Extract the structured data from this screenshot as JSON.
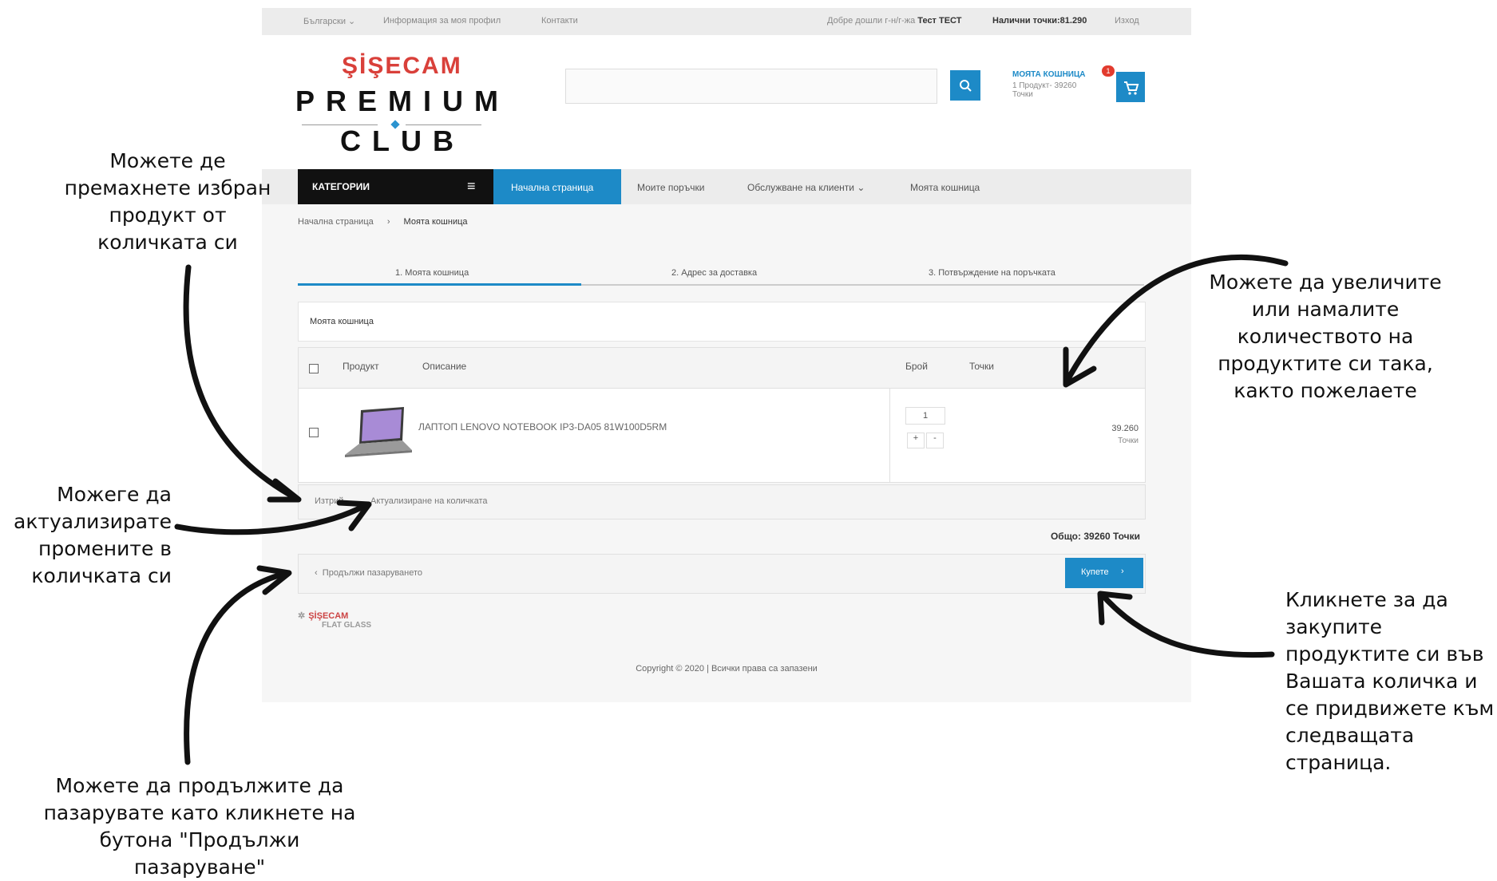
{
  "topbar": {
    "language": "Български",
    "profile": "Информация за моя профил",
    "contacts": "Контакти",
    "welcome": "Добре дошли г-н/г-жа",
    "user": "Тест ТЕСТ",
    "points": "Налични точки:81.290",
    "logout": "Изход"
  },
  "logo": {
    "brand": "ŞİŞECAM",
    "premium": "PREMIUM",
    "club": "CLUB"
  },
  "search": {
    "placeholder": ""
  },
  "cart": {
    "title": "МОЯТА КОШНИЦА",
    "count": "1",
    "summary": "1 Продукт- 39260",
    "unit": "Точки"
  },
  "nav": {
    "categories": "КАТЕГОРИИ",
    "home": "Начална страница",
    "orders": "Моите поръчки",
    "service": "Обслужване на клиенти",
    "cart": "Моята кошница"
  },
  "breadcrumb": {
    "home": "Начална страница",
    "sep": "›",
    "current": "Моята кошница"
  },
  "steps": [
    "1. Моята кошница",
    "2. Адрес за доставка",
    "3. Потвърждение на поръчката"
  ],
  "panel_title": "Моята кошница",
  "table": {
    "headers": {
      "product": "Продукт",
      "description": "Описание",
      "qty": "Брой",
      "points": "Точки"
    },
    "row": {
      "description": "ЛАПТОП LENOVO NOTEBOOK IP3-DA05 81W100D5RM",
      "qty": "1",
      "points": "39.260",
      "unit": "Точки"
    }
  },
  "actions": {
    "delete": "Изтрий",
    "update": "Актуализиране на количката"
  },
  "total": "Общо: 39260 Точки",
  "continue": "Продължи пазаруването",
  "buy": "Купете",
  "footer": {
    "brand": "ŞİŞECAM",
    "sub": "FLAT GLASS",
    "copyright": "Copyright © 2020 | Всички права са запазени"
  },
  "notes": {
    "remove": "Можете де премахнете избран продукт от количката си",
    "qty": "Можете да увеличите или намалите количеството на продуктите си така, както пожелаете",
    "update": "Можеге да актуализирате промените в количката си",
    "buy": "Кликнете за да закупите продуктите си във Вашата количка и се придвижете към следващата страница.",
    "continue": "Можете да продължите да пазарувате като кликнете на бутона \"Продължи пазаруване\""
  },
  "colors": {
    "accent": "#1d8ac7",
    "badge": "#e23b2e",
    "logo_red": "#d9403a"
  }
}
